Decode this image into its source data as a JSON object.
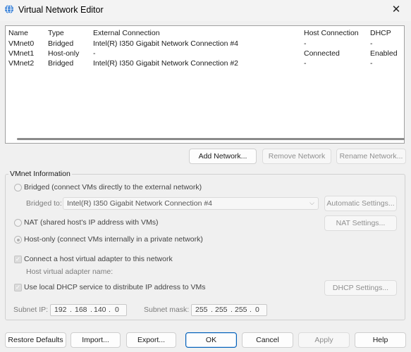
{
  "window": {
    "title": "Virtual Network Editor",
    "close_glyph": "✕"
  },
  "table": {
    "columns": [
      "Name",
      "Type",
      "External Connection",
      "Host Connection",
      "DHCP"
    ],
    "rows": [
      [
        "VMnet0",
        "Bridged",
        "Intel(R) I350 Gigabit Network Connection #4",
        "-",
        "-"
      ],
      [
        "VMnet1",
        "Host-only",
        "-",
        "Connected",
        "Enabled"
      ],
      [
        "VMnet2",
        "Bridged",
        "Intel(R) I350 Gigabit Network Connection #2",
        "-",
        "-"
      ]
    ]
  },
  "network_buttons": {
    "add": "Add Network...",
    "remove": "Remove Network",
    "rename": "Rename Network..."
  },
  "vmnet_info": {
    "group_title": "VMnet Information",
    "bridged_label": "Bridged (connect VMs directly to the external network)",
    "bridged_to_label": "Bridged to:",
    "bridged_to_value": "Intel(R) I350 Gigabit Network Connection #4",
    "automatic_settings": "Automatic Settings...",
    "nat_label": "NAT (shared host's IP address with VMs)",
    "nat_settings": "NAT Settings...",
    "hostonly_label": "Host-only (connect VMs internally in a private network)",
    "selected_mode": "Host-only",
    "connect_adapter_label": "Connect a host virtual adapter to this network",
    "connect_adapter_checked": true,
    "adapter_name_label": "Host virtual adapter name:",
    "dhcp_label": "Use local DHCP service to distribute IP address to VMs",
    "dhcp_checked": true,
    "dhcp_settings": "DHCP Settings...",
    "subnet_ip_label": "Subnet IP:",
    "subnet_ip": [
      "192",
      "168",
      "140",
      "0"
    ],
    "subnet_mask_label": "Subnet mask:",
    "subnet_mask": [
      "255",
      "255",
      "255",
      "0"
    ]
  },
  "footer": {
    "restore": "Restore Defaults",
    "import": "Import...",
    "export": "Export...",
    "ok": "OK",
    "cancel": "Cancel",
    "apply": "Apply",
    "help": "Help"
  },
  "colors": {
    "accent": "#005fb8",
    "background": "#f0f0f0",
    "disabled_text": "#8f8f8f"
  },
  "icons": {
    "app": "network-globe-icon",
    "close": "close-icon",
    "combo": "chevron-down-icon"
  }
}
